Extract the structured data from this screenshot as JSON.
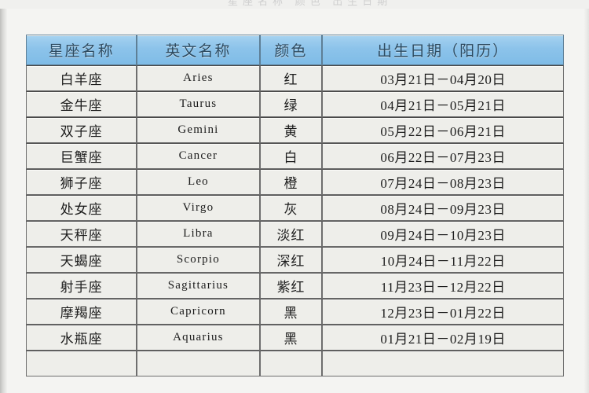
{
  "page": {
    "top_faint_text": "星座名称 颜色 出生日期",
    "background_color": "#f4f4f2",
    "header_color": "#8cc3ea",
    "grid_line_color": "#6e6e6e"
  },
  "table": {
    "columns": [
      {
        "key": "name",
        "label": "星座名称"
      },
      {
        "key": "en",
        "label": "英文名称"
      },
      {
        "key": "color",
        "label": "颜色"
      },
      {
        "key": "date",
        "label": "出生日期（阳历）"
      }
    ],
    "rows": [
      {
        "name": "白羊座",
        "en": "Aries",
        "color": "红",
        "date": "03月21日－04月20日"
      },
      {
        "name": "金牛座",
        "en": "Taurus",
        "color": "绿",
        "date": "04月21日－05月21日"
      },
      {
        "name": "双子座",
        "en": "Gemini",
        "color": "黄",
        "date": "05月22日－06月21日"
      },
      {
        "name": "巨蟹座",
        "en": "Cancer",
        "color": "白",
        "date": "06月22日－07月23日"
      },
      {
        "name": "狮子座",
        "en": "Leo",
        "color": "橙",
        "date": "07月24日－08月23日"
      },
      {
        "name": "处女座",
        "en": "Virgo",
        "color": "灰",
        "date": "08月24日－09月23日"
      },
      {
        "name": "天秤座",
        "en": "Libra",
        "color": "淡红",
        "date": "09月24日－10月23日"
      },
      {
        "name": "天蝎座",
        "en": "Scorpio",
        "color": "深红",
        "date": "10月24日－11月22日"
      },
      {
        "name": "射手座",
        "en": "Sagittarius",
        "color": "紫红",
        "date": "11月23日－12月22日"
      },
      {
        "name": "摩羯座",
        "en": "Capricorn",
        "color": "黑",
        "date": "12月23日－01月22日"
      },
      {
        "name": "水瓶座",
        "en": "Aquarius",
        "color": "黑",
        "date": "01月21日－02月19日"
      }
    ]
  }
}
